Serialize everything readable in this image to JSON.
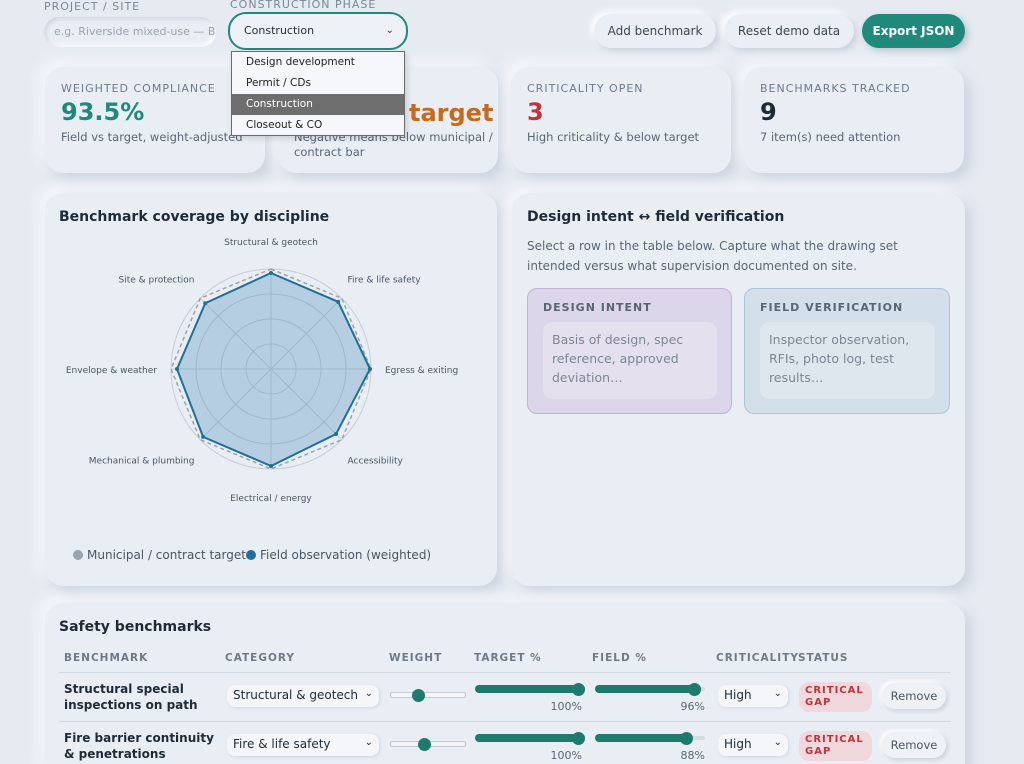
{
  "top": {
    "project_label": "PROJECT / SITE",
    "project_placeholder": "e.g. Riverside mixed-use — Bl",
    "phase_label": "CONSTRUCTION PHASE",
    "phase_value": "Construction",
    "phase_options": [
      "Design development",
      "Permit / CDs",
      "Construction",
      "Closeout & CO"
    ],
    "add_benchmark": "Add benchmark",
    "reset_demo": "Reset demo data",
    "export_json": "Export JSON"
  },
  "stats": [
    {
      "label": "WEIGHTED COMPLIANCE",
      "value": "93.5%",
      "sub": "Field vs target, weight-adjusted",
      "color": "#1f8a7c"
    },
    {
      "label": "",
      "value": "target",
      "sub": "Negative means below municipal / contract bar",
      "color": "#c8691c"
    },
    {
      "label": "CRITICALITY OPEN",
      "value": "3",
      "sub": "High criticality & below target",
      "color": "#c0343b"
    },
    {
      "label": "BENCHMARKS TRACKED",
      "value": "9",
      "sub": "7 item(s) need attention",
      "color": "#1f2a37"
    }
  ],
  "radar": {
    "title": "Benchmark coverage by discipline",
    "legend_target": "Municipal / contract target",
    "legend_field": "Field observation (weighted)"
  },
  "chart_data": {
    "type": "radar",
    "title": "Benchmark coverage by discipline",
    "categories": [
      "Structural & geotech",
      "Fire & life safety",
      "Egress & exiting",
      "Accessibility",
      "Electrical / energy",
      "Mechanical & plumbing",
      "Envelope & weather",
      "Site & protection"
    ],
    "series": [
      {
        "name": "Municipal / contract target",
        "values": [
          100,
          100,
          100,
          100,
          100,
          100,
          100,
          100
        ],
        "color": "#9aa2ac"
      },
      {
        "name": "Field observation (weighted)",
        "values": [
          96,
          95,
          99,
          92,
          97,
          96,
          94,
          93
        ],
        "color": "#1f6f96"
      }
    ],
    "rlim": [
      0,
      100
    ],
    "legend": "bottom"
  },
  "intent": {
    "title": "Design intent ↔ field verification",
    "desc": "Select a row in the table below. Capture what the drawing set intended versus what supervision documented on site.",
    "design_head": "DESIGN INTENT",
    "design_placeholder": "Basis of design, spec reference, approved deviation…",
    "field_head": "FIELD VERIFICATION",
    "field_placeholder": "Inspector observation, RFIs, photo log, test results…"
  },
  "table": {
    "title": "Safety benchmarks",
    "headers": [
      "BENCHMARK",
      "CATEGORY",
      "WEIGHT",
      "TARGET %",
      "FIELD %",
      "CRITICALITY",
      "STATUS"
    ],
    "rows": [
      {
        "name": "Structural special inspections on path",
        "category": "Structural & geotech",
        "weight": 0.35,
        "target": 100,
        "target_label": "100%",
        "field": 96,
        "field_label": "96%",
        "criticality": "High",
        "status": "CRITICAL GAP",
        "remove": "Remove"
      },
      {
        "name": "Fire barrier continuity & penetrations",
        "category": "Fire & life safety",
        "weight": 0.45,
        "target": 100,
        "target_label": "100%",
        "field": 88,
        "field_label": "88%",
        "criticality": "High",
        "status": "CRITICAL GAP",
        "remove": "Remove"
      }
    ]
  }
}
